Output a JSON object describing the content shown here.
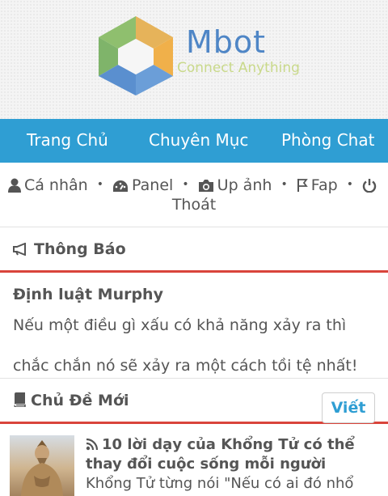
{
  "header": {
    "brand": "Mbot",
    "tagline": "Connect Anything"
  },
  "nav": {
    "items": [
      {
        "label": "Trang Chủ"
      },
      {
        "label": "Chuyên Mục"
      },
      {
        "label": "Phòng Chat"
      }
    ]
  },
  "usermenu": {
    "profile": "Cá nhân",
    "panel": "Panel",
    "upload": "Up ảnh",
    "fap": "Fap",
    "logout": "Thoát",
    "separator": "•"
  },
  "announcement": {
    "heading": "Thông Báo",
    "title": "Định luật Murphy",
    "body": "Nếu một điều gì xấu có khả năng xảy ra thì chắc chắn nó sẽ xảy ra một cách tồi tệ nhất!"
  },
  "new_topics": {
    "heading": "Chủ Đề Mới",
    "write_button": "Viết",
    "items": [
      {
        "title": "10 lời dạy của Khổng Tử có thể thay đổi cuộc sống mỗi người",
        "excerpt": "Khổng Tử từng nói \"Nếu có ai đó nhổ"
      }
    ]
  },
  "colors": {
    "navbar": "#2f9ed3",
    "section_border": "#d9443b",
    "text": "#555555",
    "brand": "#4f86c6",
    "tagline": "#c9d98a"
  }
}
